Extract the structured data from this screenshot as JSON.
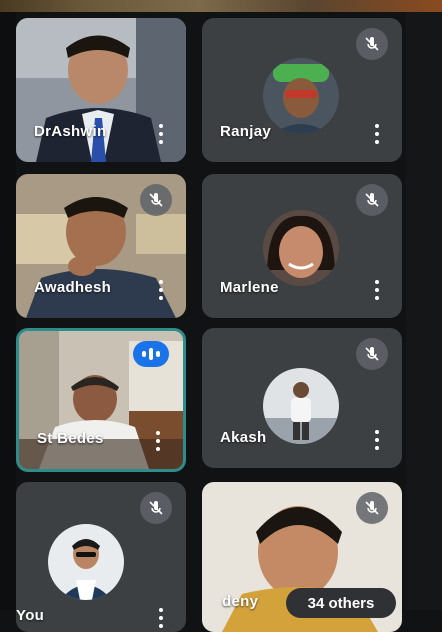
{
  "participants": [
    {
      "name": "DrAshwin",
      "muted": false
    },
    {
      "name": "Ranjay",
      "muted": true
    },
    {
      "name": "Awadhesh",
      "muted": true
    },
    {
      "name": "Marlene",
      "muted": true
    },
    {
      "name": "St Bedes",
      "muted": false,
      "speaking": true
    },
    {
      "name": "Akash",
      "muted": true
    },
    {
      "name": "You",
      "muted": true
    },
    {
      "name": "deny",
      "muted": true
    }
  ],
  "others_label": "34 others",
  "colors": {
    "tile": "#3c4043",
    "speaking_border": "#2d8c8c",
    "speaking_badge": "#1a73e8"
  },
  "icons": [
    "mic-off-icon",
    "speaking-icon",
    "more-options-icon"
  ]
}
